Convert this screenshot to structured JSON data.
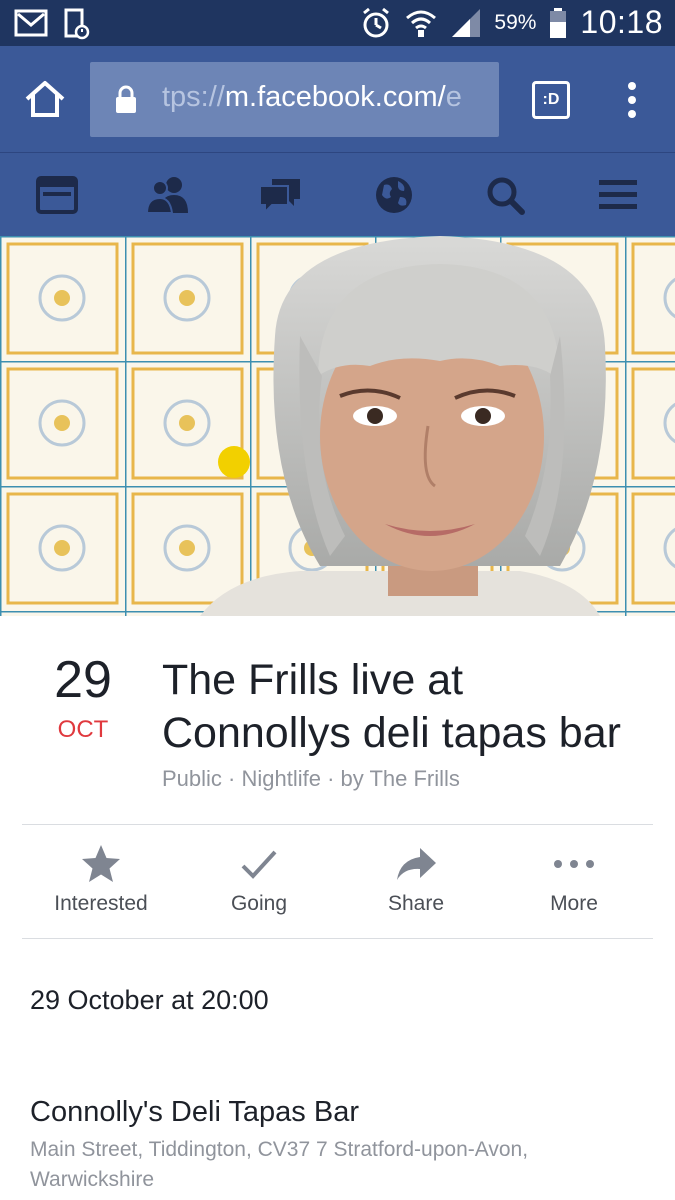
{
  "status_bar": {
    "battery": "59%",
    "time": "10:18",
    "icons": [
      "gmail-icon",
      "phone-icon",
      "alarm-icon",
      "wifi-icon",
      "signal-icon",
      "battery-icon"
    ]
  },
  "browser": {
    "url_prefix": "tps://",
    "url_main": "m.facebook.com/",
    "url_tail": "e",
    "tab_label": ":D"
  },
  "fb_nav": {
    "items": [
      "feed-icon",
      "friends-icon",
      "messages-icon",
      "notifications-globe-icon",
      "search-icon",
      "menu-icon"
    ]
  },
  "event": {
    "day": "29",
    "month": "OCT",
    "title": "The Frills live at Connollys deli tapas bar",
    "meta": "Public · Nightlife · by The Frills"
  },
  "actions": [
    {
      "label": "Interested",
      "icon": "star-icon"
    },
    {
      "label": "Going",
      "icon": "check-icon"
    },
    {
      "label": "Share",
      "icon": "share-arrow-icon"
    },
    {
      "label": "More",
      "icon": "more-dots-icon"
    }
  ],
  "details": {
    "when": "29 October at 20:00",
    "venue": "Connolly's Deli Tapas Bar",
    "address": "Main Street, Tiddington, CV37 7 Stratford-upon-Avon, Warwickshire"
  },
  "colors": {
    "status_bar": "#1f3560",
    "brand": "#3b5998",
    "url_box": "#6d85b6",
    "month_red": "#e0393e",
    "meta_gray": "#90949c",
    "nav_icon": "#1d2a4a"
  }
}
